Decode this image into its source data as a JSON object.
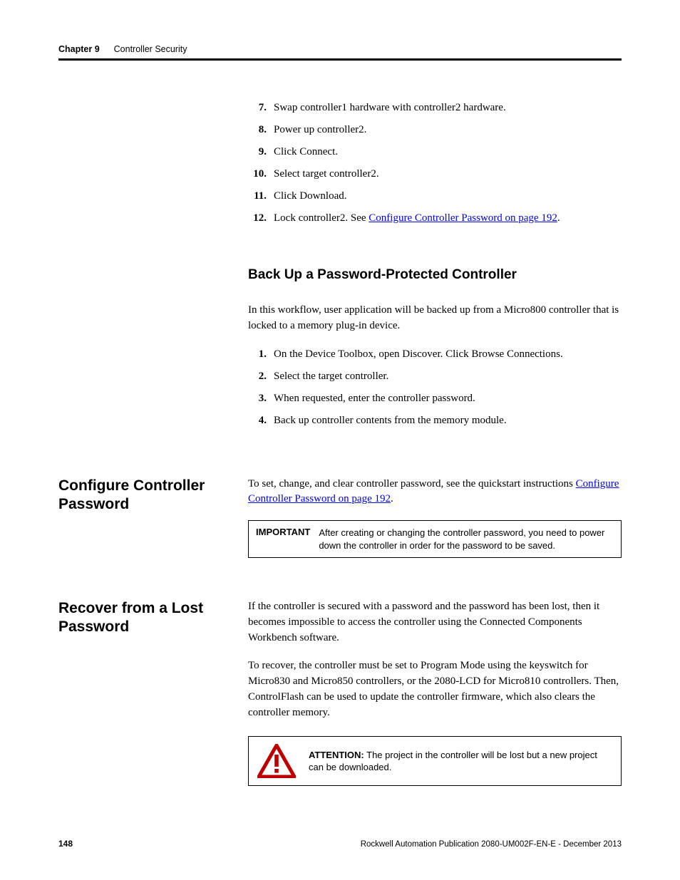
{
  "header": {
    "chapter_label": "Chapter 9",
    "chapter_title": "Controller Security"
  },
  "steps_top": [
    {
      "n": "7.",
      "t": "Swap controller1 hardware with controller2 hardware."
    },
    {
      "n": "8.",
      "t": "Power up controller2."
    },
    {
      "n": "9.",
      "t": "Click Connect."
    },
    {
      "n": "10.",
      "t": "Select target controller2."
    },
    {
      "n": "11.",
      "t": "Click Download."
    },
    {
      "n": "12.",
      "t_pre": "Lock controller2. See ",
      "t_link": "Configure Controller Password on page 192",
      "t_post": "."
    }
  ],
  "backup": {
    "heading": "Back Up a Password-Protected Controller",
    "intro": "In this workflow, user application will be backed up from a Micro800 controller that is locked to a memory plug-in device.",
    "steps": [
      {
        "n": "1.",
        "t": "On the Device Toolbox, open Discover. Click Browse Connections."
      },
      {
        "n": "2.",
        "t": "Select the target controller."
      },
      {
        "n": "3.",
        "t": "When requested, enter the controller password."
      },
      {
        "n": "4.",
        "t": "Back up controller contents from the memory module."
      }
    ]
  },
  "configure": {
    "heading": "Configure Controller Password",
    "body_pre": "To set, change, and clear controller password, see the quickstart instructions ",
    "body_link": "Configure Controller Password on page 192",
    "body_post": ".",
    "important_label": "IMPORTANT",
    "important_text": "After creating or changing the controller password, you need to power down the controller in order for the password to be saved."
  },
  "recover": {
    "heading": "Recover from a Lost Password",
    "p1": "If the controller is secured with a password and the password has been lost, then it becomes impossible to access the controller using the Connected Components Workbench software.",
    "p2": "To recover, the controller must be set to Program Mode using the keyswitch for Micro830 and Micro850 controllers, or the 2080-LCD for Micro810 controllers. Then, ControlFlash can be used to update the controller firmware, which also clears the controller memory.",
    "attention_label": "ATTENTION:",
    "attention_text": " The project in the controller will be lost but a new project can be downloaded."
  },
  "footer": {
    "page": "148",
    "pub": "Rockwell Automation Publication 2080-UM002F-EN-E - December 2013"
  }
}
